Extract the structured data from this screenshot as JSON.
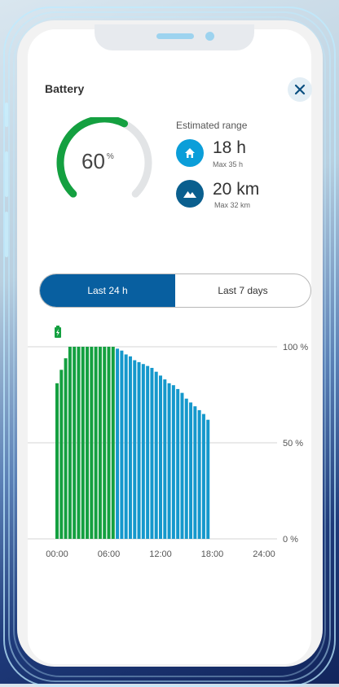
{
  "header": {
    "title": "Battery"
  },
  "gauge": {
    "value": "60",
    "unit": "%",
    "fraction": 0.6,
    "colors": {
      "fill": "#14a040",
      "track": "#e2e4e6"
    }
  },
  "range": {
    "label": "Estimated range",
    "time": {
      "value": "18 h",
      "max": "Max 35 h",
      "icon": "home-icon"
    },
    "distance": {
      "value": "20 km",
      "max": "Max  32 km",
      "icon": "mountain-icon"
    }
  },
  "tabs": [
    {
      "label": "Last 24 h",
      "active": true
    },
    {
      "label": "Last 7 days",
      "active": false
    }
  ],
  "chart_data": {
    "type": "bar",
    "x_ticks": [
      "00:00",
      "06:00",
      "12:00",
      "18:00",
      "24:00"
    ],
    "y_ticks": [
      "100 %",
      "50 %",
      "0 %"
    ],
    "ylim": [
      0,
      100
    ],
    "xlim": [
      0,
      24
    ],
    "marker_icon": "battery-charging-icon",
    "series": [
      {
        "status": "charging",
        "color": "#14a040",
        "x": [
          0,
          0.5,
          1,
          1.5,
          2,
          2.5,
          3,
          3.5,
          4,
          4.5,
          5,
          5.5,
          6,
          6.5
        ],
        "values": [
          81,
          88,
          94,
          100,
          100,
          100,
          100,
          100,
          100,
          100,
          100,
          100,
          100,
          100
        ]
      },
      {
        "status": "discharging",
        "color": "#1598cc",
        "x": [
          7,
          7.5,
          8,
          8.5,
          9,
          9.5,
          10,
          10.5,
          11,
          11.5,
          12,
          12.5,
          13,
          13.5,
          14,
          14.5,
          15,
          15.5,
          16,
          16.5,
          17,
          17.5
        ],
        "values": [
          99,
          98,
          96,
          95,
          93,
          92,
          91,
          90,
          89,
          87,
          85,
          83,
          81,
          80,
          78,
          76,
          73,
          71,
          69,
          67,
          65,
          62
        ]
      }
    ]
  }
}
